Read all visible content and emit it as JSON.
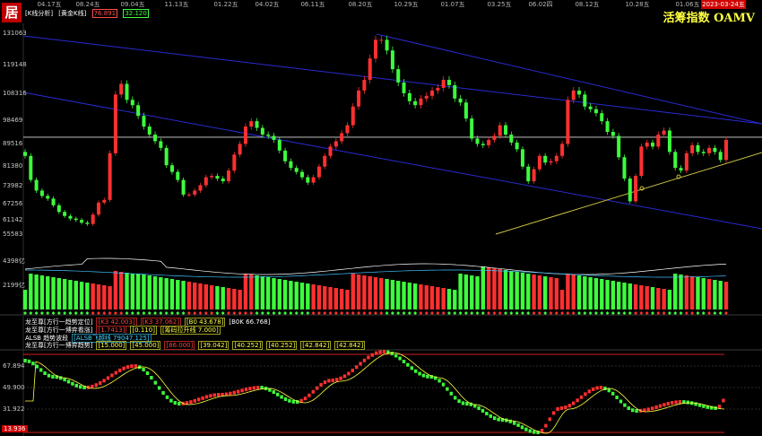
{
  "app": {
    "logo_char": "居",
    "index_title": "活筹指数 OAMV"
  },
  "date_axis": [
    "04.17五",
    "08.24五",
    "09.04五",
    "11.13五",
    "01.22五",
    "04.02五",
    "06.11五",
    "08.20五",
    "10.29五",
    "01.07五",
    "03.25五",
    "06.02四",
    "08.12五",
    "10.28五",
    "01.06五"
  ],
  "current_date": "2023-03-24五",
  "tabs": {
    "k_analysis": "[K线分析]",
    "gold_k": "[黄金K线]",
    "val_red": "76.891",
    "val_green": "32.120"
  },
  "price_axis": [
    "131063",
    "119148",
    "108316",
    "98469",
    "89516",
    "81380",
    "73982",
    "67256",
    "61142",
    "55583"
  ],
  "volume_axis": [
    "4398亿",
    "2199亿"
  ],
  "indicator_rows": [
    {
      "items": [
        {
          "t": "龙至尊[方行一趋势定位]",
          "c": "w"
        },
        {
          "t": "[K3 42.003]",
          "c": "r"
        },
        {
          "t": "[K3 37.062]",
          "c": "r"
        },
        {
          "t": "[B0 43.678]",
          "c": "y"
        },
        {
          "t": "[B0K 66.768]",
          "c": "w"
        }
      ]
    },
    {
      "items": [
        {
          "t": "龙至尊[方行一博弈看涨]",
          "c": "w"
        },
        {
          "t": "[1.7413]",
          "c": "r"
        },
        {
          "t": "[0.110]",
          "c": "y"
        },
        {
          "t": "[筹码拉升线 7.000]",
          "c": "y"
        }
      ]
    },
    {
      "items": [
        {
          "t": "ALSB 趋势波段",
          "c": "w"
        },
        {
          "t": "[ALSB飞越线 79047.125]",
          "c": "c"
        }
      ]
    },
    {
      "items": [
        {
          "t": "龙至尊[方行一博弈趋势]",
          "c": "w"
        },
        {
          "t": "[15.000]",
          "c": "y"
        },
        {
          "t": "[45.000]",
          "c": "y"
        },
        {
          "t": "[86.000]",
          "c": "r"
        },
        {
          "t": "[39.042]",
          "c": "y"
        },
        {
          "t": "[40.252]",
          "c": "y"
        },
        {
          "t": "[40.252]",
          "c": "y"
        },
        {
          "t": "[42.842]",
          "c": "y"
        },
        {
          "t": "[42.842]",
          "c": "y"
        }
      ]
    }
  ],
  "osc_axis": [
    "67.894",
    "49.900",
    "31.922"
  ],
  "osc_low": "13.936",
  "colors": {
    "up": "#ff3030",
    "down": "#3dfc3d",
    "channel": "#2a2ad0",
    "support": "#c8c040",
    "level": "#dddddd",
    "fast": "#ffff40",
    "slow": "#ffffff",
    "ref": "#d02020"
  },
  "chart_data": {
    "type": "candlestick",
    "closes": [
      85000,
      76000,
      72000,
      70000,
      69000,
      66500,
      64000,
      62500,
      61500,
      61000,
      60000,
      59500,
      63000,
      67500,
      68500,
      86000,
      108000,
      112000,
      106000,
      104000,
      100000,
      96000,
      93000,
      90500,
      88000,
      81500,
      79000,
      76000,
      70500,
      70500,
      72000,
      74000,
      77000,
      77500,
      76500,
      75500,
      79500,
      85500,
      89500,
      96000,
      98000,
      95500,
      93000,
      92500,
      91000,
      87000,
      83000,
      80500,
      79000,
      77000,
      75000,
      77000,
      81000,
      85000,
      88500,
      90500,
      93500,
      96500,
      103500,
      109500,
      113500,
      121500,
      128500,
      128500,
      124500,
      117500,
      112500,
      108500,
      105500,
      104000,
      106500,
      107500,
      109500,
      110500,
      113500,
      111500,
      106500,
      105000,
      99000,
      91500,
      89500,
      89000,
      91000,
      92500,
      96500,
      93000,
      90000,
      87500,
      81000,
      75500,
      80000,
      85000,
      82500,
      83000,
      85000,
      89500,
      106000,
      109500,
      108000,
      103500,
      102500,
      101000,
      98000,
      94000,
      92500,
      84500,
      76500,
      68000,
      77500,
      88500,
      90000,
      88500,
      93000,
      94500,
      86500,
      80500,
      79500,
      86000,
      89000,
      86500,
      86000,
      88000,
      86500,
      83500,
      91000
    ]
  }
}
